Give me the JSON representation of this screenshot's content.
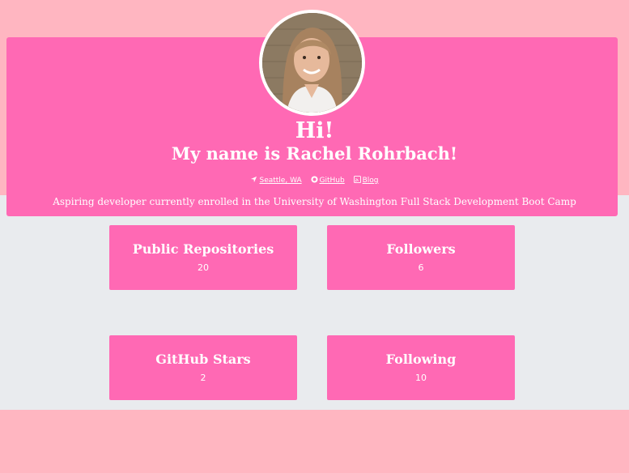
{
  "colors": {
    "page_bg": "#ffb6c1",
    "band_bg": "#e9ebee",
    "accent": "#ff69b4",
    "text": "#ffffff"
  },
  "profile": {
    "greeting": "Hi!",
    "name_line": "My name is Rachel Rohrbach!",
    "bio": "Aspiring developer currently enrolled in the University of Washington Full Stack Development Boot Camp",
    "links": [
      {
        "icon": "location-arrow-icon",
        "label": "Seattle, WA"
      },
      {
        "icon": "github-icon",
        "label": "GitHub"
      },
      {
        "icon": "rss-icon",
        "label": "Blog"
      }
    ]
  },
  "stats": [
    {
      "label": "Public Repositories",
      "value": "20"
    },
    {
      "label": "Followers",
      "value": "6"
    },
    {
      "label": "GitHub Stars",
      "value": "2"
    },
    {
      "label": "Following",
      "value": "10"
    }
  ]
}
